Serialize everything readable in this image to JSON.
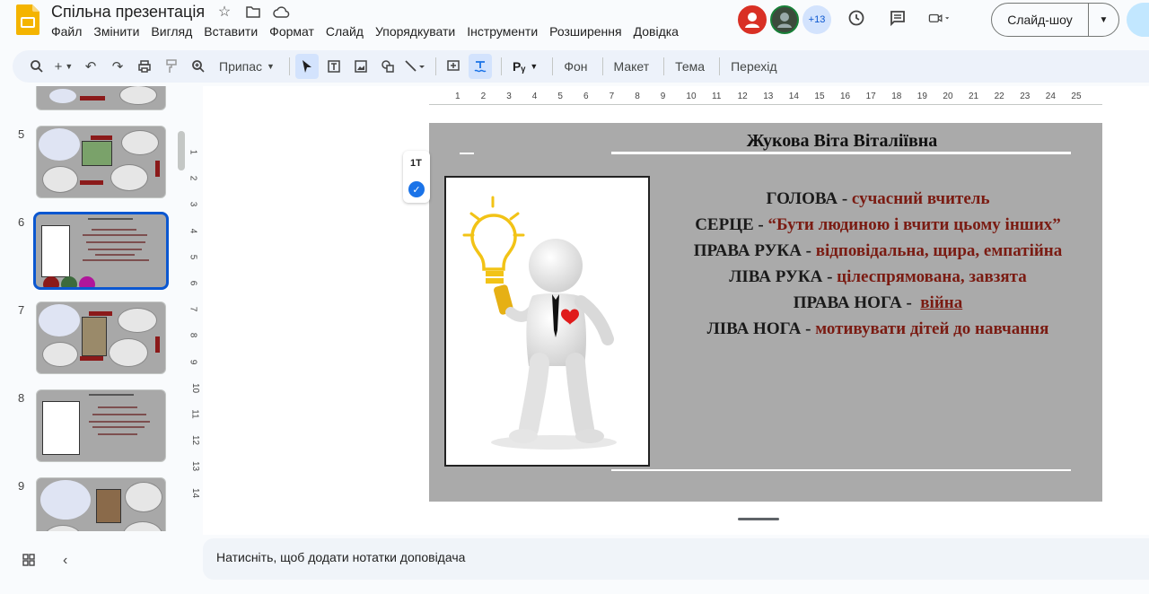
{
  "app": {
    "doc_title": "Спільна презентація",
    "menu": [
      "Файл",
      "Змінити",
      "Вигляд",
      "Вставити",
      "Формат",
      "Слайд",
      "Упорядкувати",
      "Інструменти",
      "Розширення",
      "Довідка"
    ],
    "collaborators_more": "+13",
    "slideshow_label": "Слайд-шоу"
  },
  "toolbar": {
    "fit_label": "Припас",
    "bg_label": "Фон",
    "layout_label": "Макет",
    "theme_label": "Тема",
    "transition_label": "Перехід",
    "rv_label": "Pᵧ"
  },
  "filmstrip": {
    "slide_numbers": [
      "5",
      "6",
      "7",
      "8",
      "9"
    ],
    "selected": "6"
  },
  "ruler": {
    "h_ticks": [
      "1",
      "2",
      "3",
      "4",
      "5",
      "6",
      "7",
      "8",
      "9",
      "10",
      "11",
      "12",
      "13",
      "14",
      "15",
      "16",
      "17",
      "18",
      "19",
      "20",
      "21",
      "22",
      "23",
      "24",
      "25"
    ],
    "v_ticks": [
      "1",
      "2",
      "3",
      "4",
      "5",
      "6",
      "7",
      "8",
      "9",
      "10",
      "11",
      "12",
      "13",
      "14"
    ]
  },
  "slide": {
    "name": "Жукова Віта Віталіївна",
    "lines": [
      {
        "key": "ГОЛОВА - ",
        "value": "сучасний вчитель"
      },
      {
        "key": "СЕРЦЕ - ",
        "value": "“Бути людиною і вчити цьому інших”"
      },
      {
        "key": "ПРАВА РУКА - ",
        "value": "відповідальна, щира, емпатійна"
      },
      {
        "key": "ЛІВА РУКА - ",
        "value": "цілеспрямована, завзята"
      },
      {
        "key": "ПРАВА НОГА -  ",
        "value": "війна",
        "underline": true
      },
      {
        "key": "ЛІВА НОГА - ",
        "value": "мотивувати дітей до навчання"
      }
    ]
  },
  "notes": {
    "placeholder": "Натисніть, щоб додати нотатки доповідача"
  },
  "colors": {
    "accent": "#0b57d0",
    "slide_bg": "#aaaaaa",
    "value_text": "#7a1b12"
  }
}
